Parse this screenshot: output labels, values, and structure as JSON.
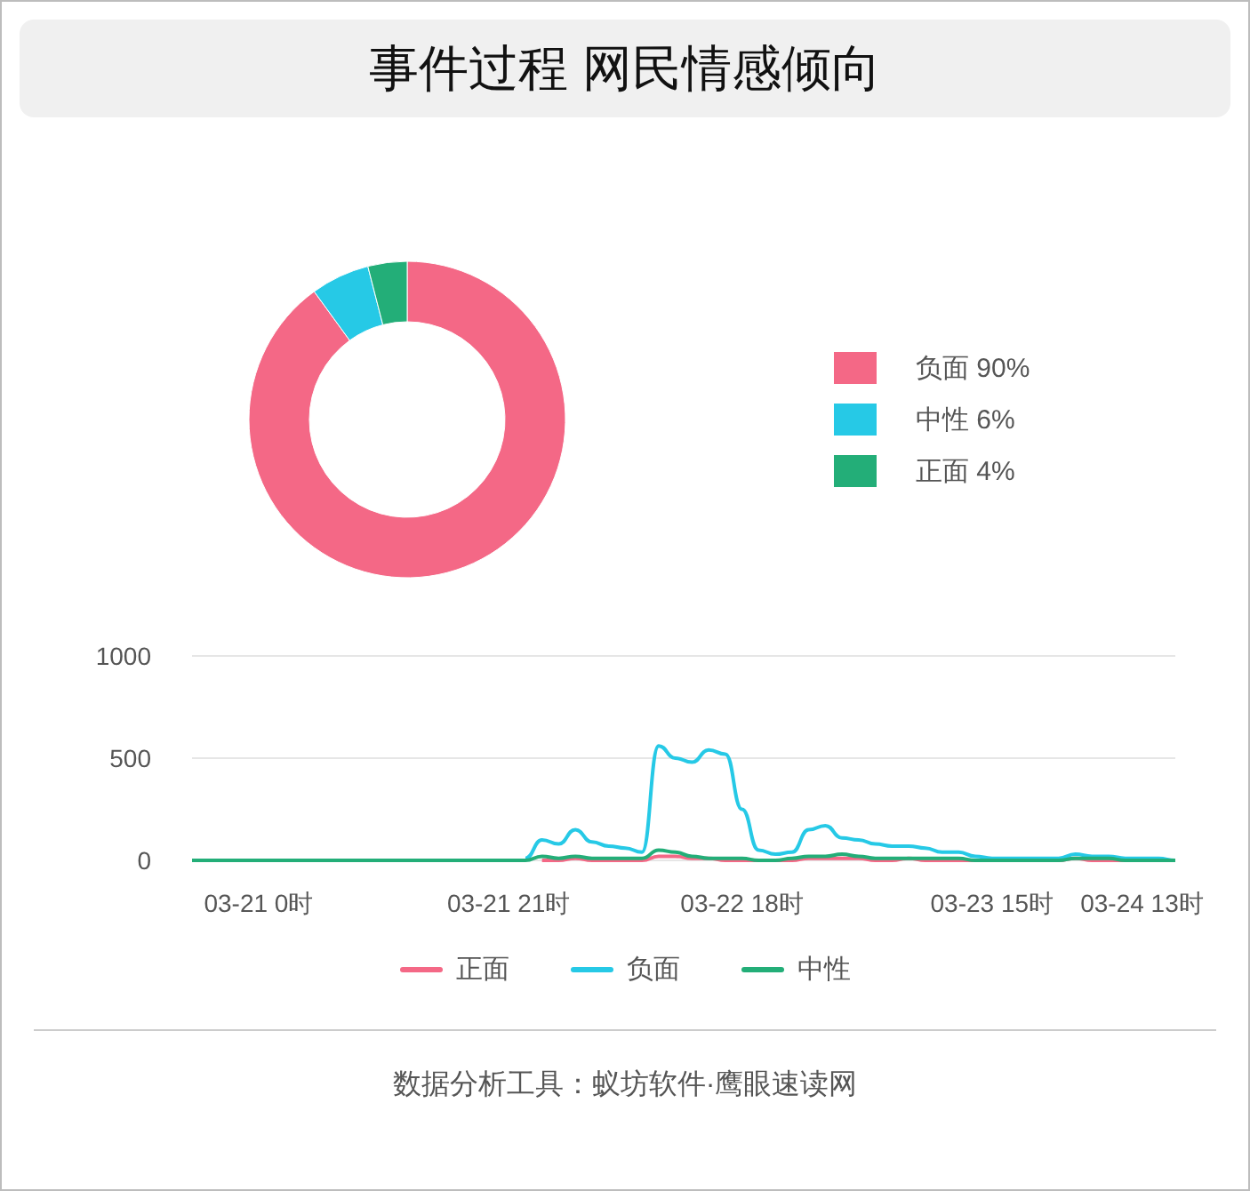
{
  "title": "事件过程 网民情感倾向",
  "sentiment": {
    "chart_data": {
      "type": "donut",
      "categories": [
        "负面",
        "中性",
        "正面"
      ],
      "values": [
        90,
        6,
        4
      ]
    },
    "legend": [
      {
        "percent": "90%",
        "color": "#f46886"
      },
      {
        "percent": "6%",
        "color": "#26c9e6"
      },
      {
        "percent": "4%",
        "color": "#23ae78"
      }
    ]
  },
  "trend": {
    "chart_data": {
      "type": "line",
      "ylim": [
        0,
        1000
      ],
      "yticks": [
        0,
        500,
        1000
      ],
      "categories": [
        null,
        null,
        null,
        null,
        "03-21 0时",
        null,
        null,
        null,
        null,
        null,
        null,
        null,
        null,
        null,
        null,
        null,
        null,
        null,
        null,
        "03-21 21时",
        null,
        null,
        null,
        null,
        null,
        null,
        null,
        null,
        null,
        null,
        null,
        null,
        null,
        "03-22 18时",
        null,
        null,
        null,
        null,
        null,
        null,
        null,
        null,
        null,
        null,
        null,
        null,
        null,
        null,
        "03-23 15时",
        null,
        null,
        null,
        null,
        null,
        null,
        null,
        null,
        "03-24 13时",
        null,
        null
      ],
      "series": [
        {
          "name": "正面",
          "color": "#f46886",
          "values": [
            null,
            null,
            null,
            null,
            null,
            null,
            null,
            null,
            null,
            null,
            null,
            null,
            null,
            null,
            null,
            null,
            null,
            null,
            null,
            null,
            null,
            0,
            0,
            10,
            0,
            0,
            0,
            0,
            20,
            20,
            10,
            10,
            0,
            0,
            0,
            0,
            0,
            10,
            10,
            10,
            10,
            0,
            0,
            10,
            0,
            0,
            0,
            0,
            0,
            0,
            0,
            0,
            0,
            10,
            0,
            0,
            0,
            0,
            null,
            null
          ]
        },
        {
          "name": "负面",
          "color": "#26c9e6",
          "values": [
            null,
            null,
            null,
            null,
            null,
            null,
            null,
            null,
            null,
            null,
            null,
            null,
            null,
            null,
            null,
            null,
            null,
            null,
            null,
            null,
            10,
            100,
            80,
            150,
            90,
            70,
            60,
            40,
            560,
            500,
            480,
            540,
            520,
            250,
            50,
            30,
            40,
            150,
            170,
            110,
            100,
            80,
            70,
            70,
            60,
            40,
            40,
            20,
            10,
            10,
            10,
            10,
            10,
            30,
            20,
            20,
            10,
            10,
            10,
            0
          ]
        },
        {
          "name": "中性",
          "color": "#23ae78",
          "values": [
            0,
            0,
            0,
            0,
            0,
            0,
            0,
            0,
            0,
            0,
            0,
            0,
            0,
            0,
            0,
            0,
            0,
            0,
            0,
            0,
            0,
            20,
            10,
            20,
            10,
            10,
            10,
            10,
            50,
            40,
            20,
            10,
            10,
            10,
            0,
            0,
            10,
            20,
            20,
            30,
            20,
            10,
            10,
            10,
            10,
            10,
            10,
            0,
            0,
            0,
            0,
            0,
            0,
            10,
            10,
            10,
            0,
            0,
            0,
            0
          ]
        }
      ]
    }
  },
  "footer": "数据分析工具：蚁坊软件·鹰眼速读网"
}
